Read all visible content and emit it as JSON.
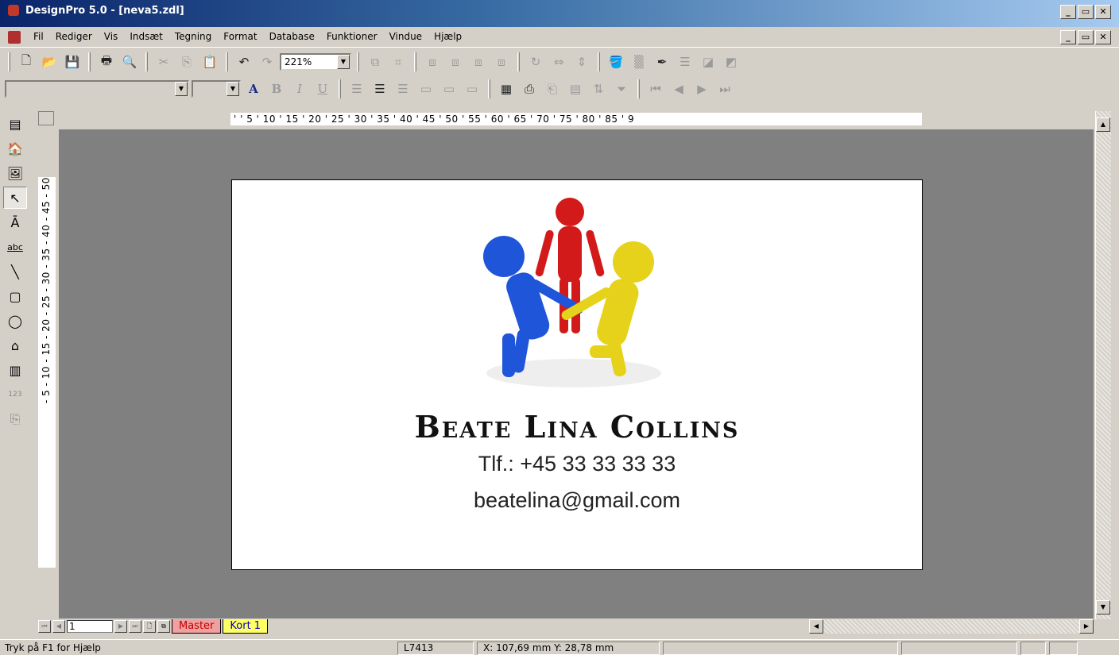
{
  "window": {
    "title": "DesignPro 5.0 - [neva5.zdl]",
    "min": "_",
    "max": "▭",
    "close": "✕"
  },
  "menus": [
    "Fil",
    "Rediger",
    "Vis",
    "Indsæt",
    "Tegning",
    "Format",
    "Database",
    "Funktioner",
    "Vindue",
    "Hjælp"
  ],
  "toolbar": {
    "zoom": "221%",
    "font_color": "A"
  },
  "ruler": {
    "horizontal": "'  '  5  '  10  '  15  '  20  '  25  '  30  '  35  '  40  '  45  '  50  '  55  '  60  '  65  '  70  '  75  '  80  '  85  '  9",
    "vertical": "-  5  -  10  -  15  -  20  -  25  -  30  -  35  -  40  -  45  -  50"
  },
  "card": {
    "name": "Beate Lina Collins",
    "phone": "Tlf.: +45 33 33 33 33",
    "email": "beatelina@gmail.com"
  },
  "page_nav": {
    "page": "1",
    "tabs": [
      "Master",
      "Kort 1"
    ]
  },
  "status": {
    "help": "Tryk på F1 for Hjælp",
    "label_code": "L7413",
    "coords": "X: 107,69 mm  Y: 28,78 mm"
  }
}
